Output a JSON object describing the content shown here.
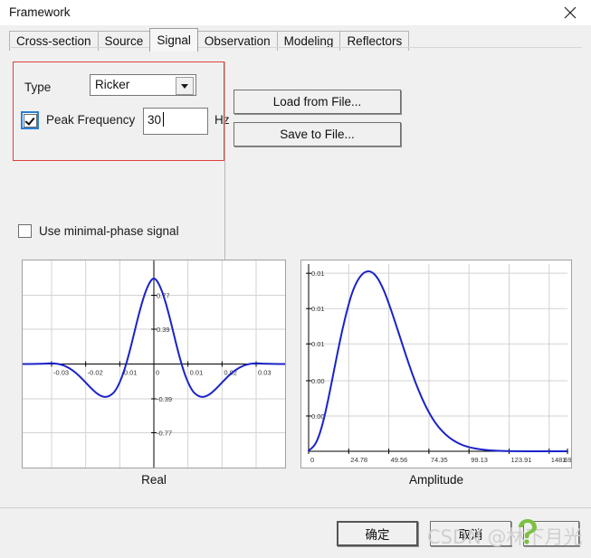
{
  "window": {
    "title": "Framework",
    "close_icon": "close-icon"
  },
  "tabs": [
    {
      "label": "Cross-section",
      "active": false
    },
    {
      "label": "Source",
      "active": false
    },
    {
      "label": "Signal",
      "active": true
    },
    {
      "label": "Observation",
      "active": false
    },
    {
      "label": "Modeling",
      "active": false
    },
    {
      "label": "Reflectors",
      "active": false
    }
  ],
  "form": {
    "type_label": "Type",
    "type_value": "Ricker",
    "type_options": [
      "Ricker"
    ],
    "peak_frequency_label": "Peak Frequency",
    "peak_frequency_value": "30",
    "peak_frequency_unit": "Hz",
    "peak_frequency_checked": true,
    "minimal_phase_label": "Use minimal-phase signal",
    "minimal_phase_checked": false,
    "highlight_color": "#e0403a"
  },
  "file_buttons": {
    "load_label": "Load from File...",
    "save_label": "Save to File..."
  },
  "dialog_buttons": {
    "ok_label": "确定",
    "cancel_label": "取消",
    "help_label": ""
  },
  "watermark": {
    "text": "CSDN @林下月光",
    "color": "#cfcfcf"
  },
  "chart_data": [
    {
      "type": "line",
      "title": "Real",
      "xlabel": "",
      "ylabel": "",
      "series_color": "#1b23c8",
      "grid": true,
      "xlim": [
        -0.0385,
        0.0385
      ],
      "ylim": [
        -1.16,
        1.16
      ],
      "xticks": [
        -0.03,
        -0.02,
        -0.01,
        0,
        0.01,
        0.02,
        0.03
      ],
      "xtick_labels": [
        "-0.03",
        "-0.02",
        "-0.01",
        "0",
        "0.01",
        "0.02",
        "0.03"
      ],
      "yticks": [
        0.77,
        0.39,
        -0.39,
        -0.77
      ],
      "ytick_labels": [
        "0.77",
        "0.39",
        "-0.39",
        "-0.77"
      ],
      "description": "Ricker wavelet, 30 Hz peak frequency, zero-phase, amplitude 1.0 at t=0",
      "x": [
        -0.0385,
        -0.035,
        -0.032,
        -0.03,
        -0.028,
        -0.026,
        -0.024,
        -0.022,
        -0.02,
        -0.018,
        -0.016,
        -0.014,
        -0.012,
        -0.011,
        -0.01,
        -0.009,
        -0.008,
        -0.007,
        -0.006,
        -0.005,
        -0.004,
        -0.003,
        -0.002,
        -0.001,
        0.0,
        0.001,
        0.002,
        0.003,
        0.004,
        0.005,
        0.006,
        0.007,
        0.008,
        0.009,
        0.01,
        0.011,
        0.012,
        0.014,
        0.016,
        0.018,
        0.02,
        0.022,
        0.024,
        0.026,
        0.028,
        0.03,
        0.032,
        0.035,
        0.0385
      ],
      "y": [
        0.0,
        0.001,
        0.004,
        0.009,
        0.002,
        -0.021,
        -0.064,
        -0.128,
        -0.207,
        -0.288,
        -0.352,
        -0.377,
        -0.334,
        -0.281,
        -0.206,
        -0.107,
        0.015,
        0.156,
        0.31,
        0.467,
        0.616,
        0.748,
        0.855,
        0.93,
        0.968,
        0.93,
        0.855,
        0.748,
        0.616,
        0.467,
        0.31,
        0.156,
        0.015,
        -0.107,
        -0.206,
        -0.281,
        -0.334,
        -0.377,
        -0.352,
        -0.288,
        -0.207,
        -0.128,
        -0.064,
        -0.021,
        0.002,
        0.009,
        0.004,
        0.001,
        0.0
      ]
    },
    {
      "type": "line",
      "title": "Amplitude",
      "xlabel": "",
      "ylabel": "",
      "series_color": "#1b23c8",
      "grid": true,
      "xlim": [
        0,
        160
      ],
      "ylim": [
        0,
        0.0122
      ],
      "xticks": [
        0,
        24.78,
        49.56,
        74.35,
        99.13,
        123.91,
        148.69
      ],
      "xtick_labels": [
        "0",
        "24.78",
        "49.56",
        "74.35",
        "99.13",
        "123.91",
        "148.69",
        "1"
      ],
      "yticks": [
        0.0116,
        0.0093,
        0.007,
        0.0046,
        0.0023
      ],
      "ytick_labels": [
        "0.01",
        "0.01",
        "0.01",
        "0.00",
        "0.00"
      ],
      "description": "Amplitude spectrum of a 30 Hz Ricker wavelet; peak near 39 Hz",
      "x": [
        0,
        3,
        6,
        9,
        12,
        15,
        18,
        21,
        24,
        27,
        30,
        33,
        36,
        39,
        42,
        45,
        48,
        52,
        56,
        60,
        64,
        68,
        72,
        76,
        80,
        85,
        90,
        95,
        100,
        105,
        110,
        115,
        120,
        125,
        130,
        140,
        150,
        160
      ],
      "y": [
        5e-05,
        0.00025,
        0.00085,
        0.0019,
        0.0033,
        0.0049,
        0.0065,
        0.008,
        0.0093,
        0.0104,
        0.0111,
        0.01155,
        0.01175,
        0.0117,
        0.0114,
        0.01085,
        0.0101,
        0.0089,
        0.0076,
        0.0063,
        0.00505,
        0.00395,
        0.003,
        0.00222,
        0.0016,
        0.00104,
        0.00066,
        0.0004,
        0.00024,
        0.00014,
        8e-05,
        4e-05,
        2e-05,
        1e-05,
        5e-06,
        1e-06,
        0.0,
        0.0
      ]
    }
  ]
}
